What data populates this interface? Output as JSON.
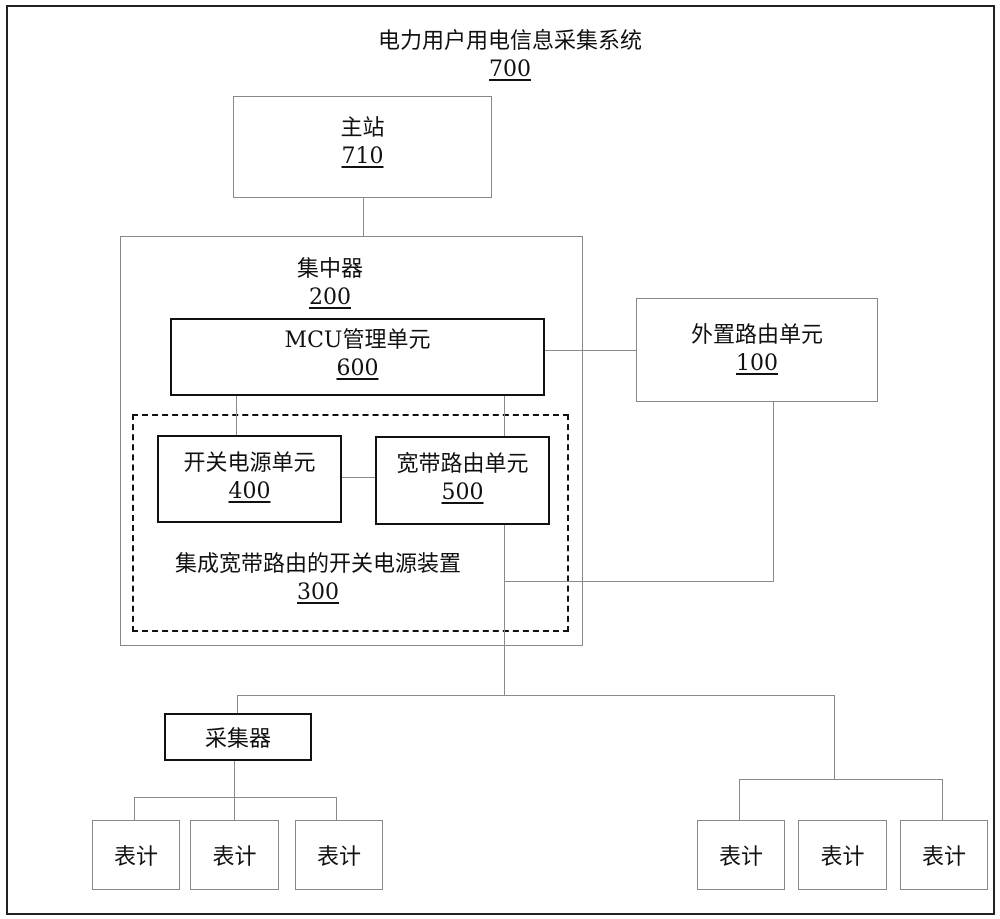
{
  "title": {
    "label": "电力用户用电信息采集系统",
    "ref": "700"
  },
  "master_station": {
    "label": "主站",
    "ref": "710"
  },
  "concentrator": {
    "label": "集中器",
    "ref": "200"
  },
  "mcu_unit": {
    "label": "MCU管理单元",
    "ref": "600"
  },
  "switch_power_unit": {
    "label": "开关电源单元",
    "ref": "400"
  },
  "broadband_router_unit": {
    "label": "宽带路由单元",
    "ref": "500"
  },
  "integrated_device": {
    "label": "集成宽带路由的开关电源装置",
    "ref": "300"
  },
  "external_router_unit": {
    "label": "外置路由单元",
    "ref": "100"
  },
  "collector": {
    "label": "采集器"
  },
  "meters_left": [
    {
      "label": "表计"
    },
    {
      "label": "表计"
    },
    {
      "label": "表计"
    }
  ],
  "meters_right": [
    {
      "label": "表计"
    },
    {
      "label": "表计"
    },
    {
      "label": "表计"
    }
  ]
}
